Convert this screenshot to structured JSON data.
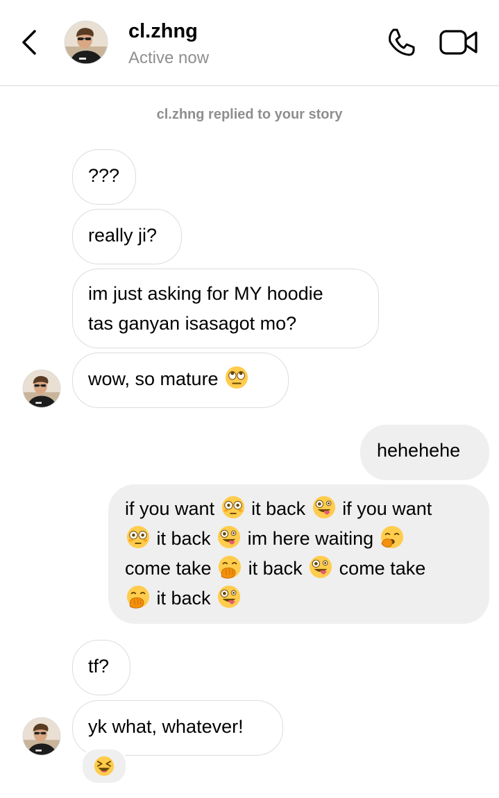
{
  "header": {
    "username": "cl.zhng",
    "status": "Active now",
    "back_icon": "chevron-left-icon",
    "call_icon": "phone-icon",
    "video_icon": "video-camera-icon"
  },
  "story_note": "cl.zhng replied to your story",
  "messages": {
    "m1": "???",
    "m2": "really ji?",
    "m3_line1": "im just asking for MY hoodie",
    "m3_line2": "tas ganyan isasagot mo?",
    "m4": "wow, so mature",
    "m5": "hehehehe",
    "m6": {
      "t1": "if you want",
      "t2": "it back",
      "t3": "if you want",
      "t4": "it back",
      "t5": "im here waiting",
      "t6": "come take",
      "t7": "it back",
      "t8": "come take",
      "t9": "it back"
    },
    "m7": "tf?",
    "m8": "yk what, whatever!"
  },
  "reaction": "laughing-squint-emoji",
  "emojis": [
    "eye-roll-emoji",
    "flushed-emoji",
    "zany-face-emoji",
    "yawning-face-emoji",
    "hand-over-mouth-emoji"
  ],
  "colors": {
    "incoming_border": "#dcdcdc",
    "outgoing_bg": "#efefef",
    "secondary_text": "#8e8e8e"
  }
}
